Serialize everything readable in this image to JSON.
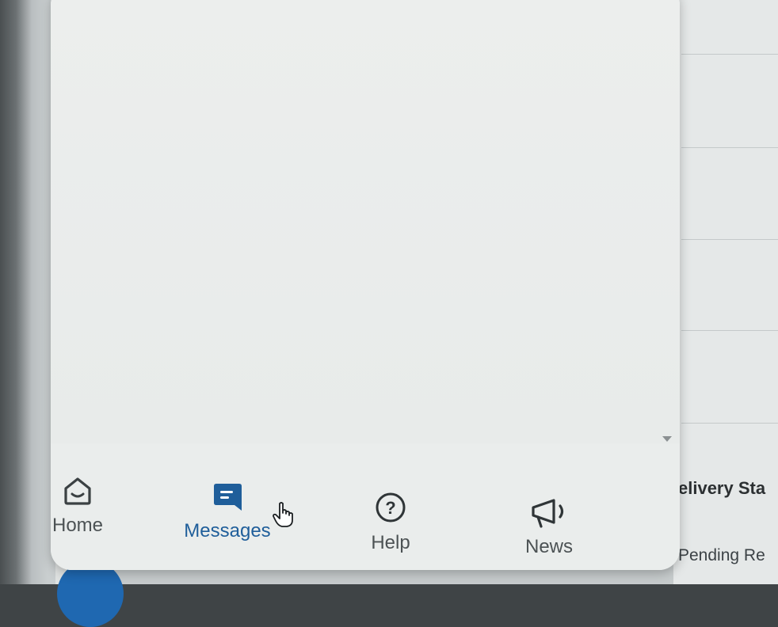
{
  "nav": {
    "items": [
      {
        "label": "Home",
        "icon": "home-icon",
        "active": false
      },
      {
        "label": "Messages",
        "icon": "message-icon",
        "active": true
      },
      {
        "label": "Help",
        "icon": "help-icon",
        "active": false
      },
      {
        "label": "News",
        "icon": "megaphone-icon",
        "active": false
      }
    ]
  },
  "background": {
    "status_label": "elivery Sta",
    "status_value": "Pending Re"
  },
  "colors": {
    "accent": "#1f5e9a",
    "inactive": "#4c5254",
    "fab": "#1f68b1"
  }
}
